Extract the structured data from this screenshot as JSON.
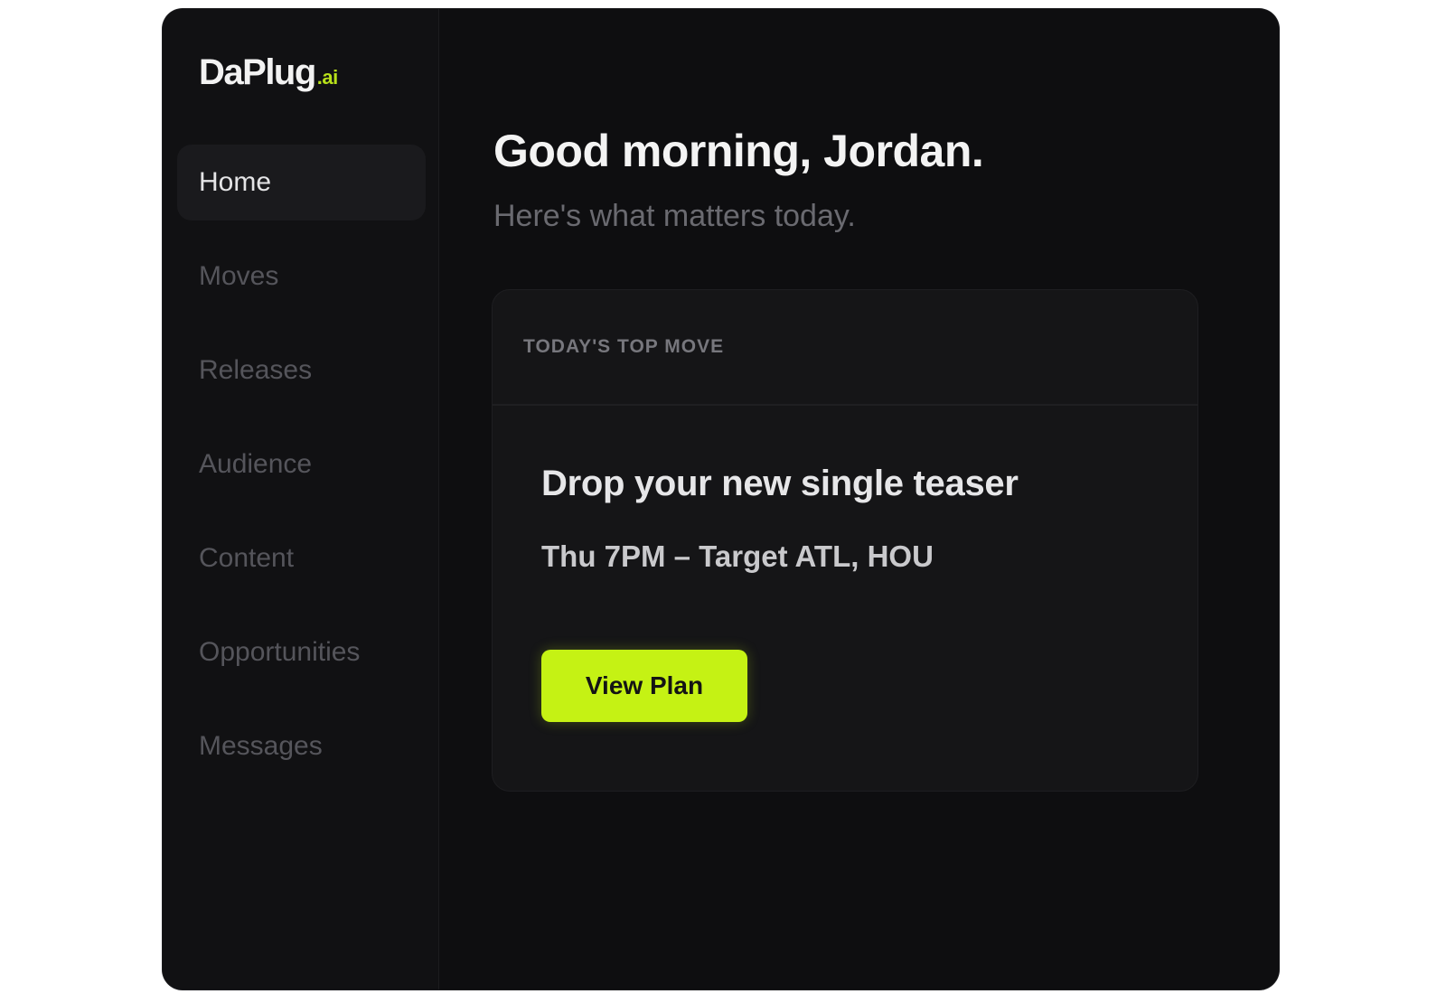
{
  "brand": {
    "name": "DaPlug",
    "suffix": ".ai",
    "accent_color": "#c5f214"
  },
  "sidebar": {
    "items": [
      {
        "label": "Home",
        "active": true
      },
      {
        "label": "Moves",
        "active": false
      },
      {
        "label": "Releases",
        "active": false
      },
      {
        "label": "Audience",
        "active": false
      },
      {
        "label": "Content",
        "active": false
      },
      {
        "label": "Opportunities",
        "active": false
      },
      {
        "label": "Messages",
        "active": false
      }
    ]
  },
  "main": {
    "greeting": "Good morning, Jordan.",
    "subtitle": "Here's what matters today."
  },
  "top_move": {
    "label": "TODAY'S TOP MOVE",
    "title": "Drop your new single teaser",
    "detail": "Thu 7PM – Target ATL, HOU",
    "button_label": "View Plan"
  }
}
